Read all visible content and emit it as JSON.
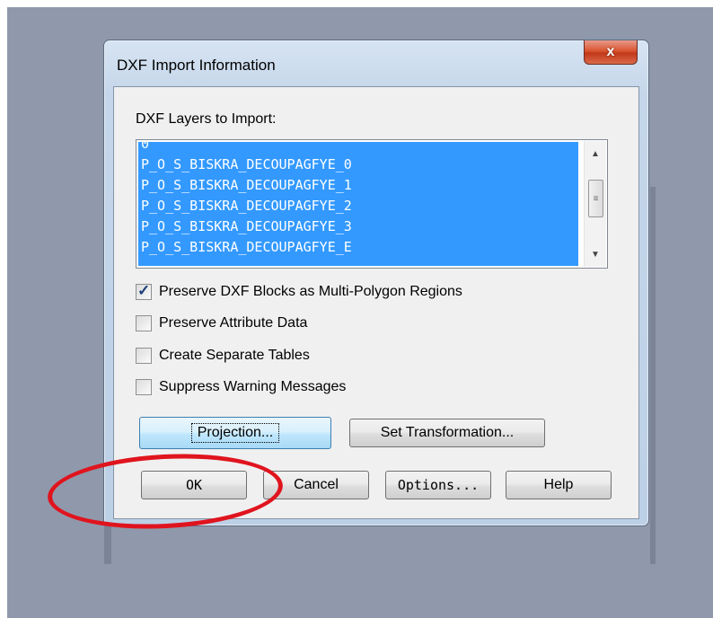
{
  "window": {
    "title": "DXF Import Information",
    "close_label": "x"
  },
  "layers": {
    "label": "DXF Layers to Import:",
    "items": [
      "0",
      "P_O_S_BISKRA_DECOUPAGFYE_0",
      "P_O_S_BISKRA_DECOUPAGFYE_1",
      "P_O_S_BISKRA_DECOUPAGFYE_2",
      "P_O_S_BISKRA_DECOUPAGFYE_3",
      "P_O_S_BISKRA_DECOUPAGFYE_E"
    ]
  },
  "options": {
    "preserve_blocks": {
      "label": "Preserve DXF Blocks as Multi-Polygon Regions",
      "checked": true
    },
    "preserve_attribute": {
      "label": "Preserve Attribute Data",
      "checked": false
    },
    "separate_tables": {
      "label": "Create Separate Tables",
      "checked": false
    },
    "suppress_warnings": {
      "label": "Suppress Warning Messages",
      "checked": false
    }
  },
  "buttons": {
    "projection": "Projection...",
    "set_transformation": "Set Transformation...",
    "ok": "OK",
    "cancel": "Cancel",
    "options": "Options...",
    "help": "Help"
  },
  "colors": {
    "selection": "#3399ff",
    "annotation": "#e0141e",
    "background": "#8f99ab"
  },
  "icons": {
    "close": "close-icon",
    "scroll_up": "chevron-up-icon",
    "scroll_down": "chevron-down-icon",
    "check": "checkmark-icon"
  }
}
